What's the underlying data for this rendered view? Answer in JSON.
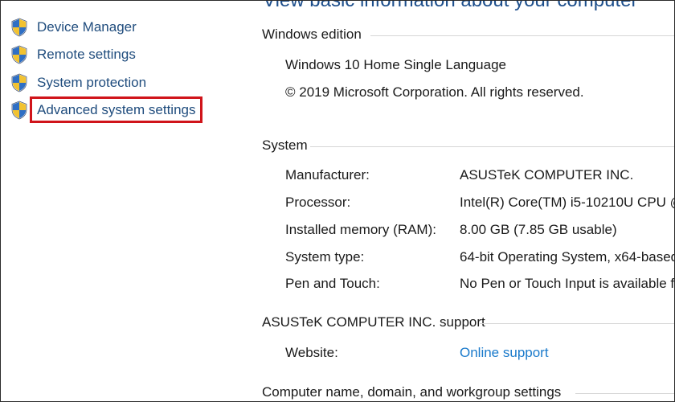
{
  "sidebar": {
    "items": [
      {
        "label": "Device Manager"
      },
      {
        "label": "Remote settings"
      },
      {
        "label": "System protection"
      },
      {
        "label": "Advanced system settings"
      }
    ]
  },
  "main": {
    "page_title": "View basic information about your computer",
    "windows_edition": {
      "header": "Windows edition",
      "edition": "Windows 10 Home Single Language",
      "copyright": "© 2019 Microsoft Corporation. All rights reserved."
    },
    "system": {
      "header": "System",
      "rows": [
        {
          "label": "Manufacturer:",
          "value": "ASUSTeK COMPUTER INC."
        },
        {
          "label": "Processor:",
          "value": "Intel(R) Core(TM) i5-10210U CPU @"
        },
        {
          "label": "Installed memory (RAM):",
          "value": "8.00 GB (7.85 GB usable)"
        },
        {
          "label": "System type:",
          "value": "64-bit Operating System, x64-based"
        },
        {
          "label": "Pen and Touch:",
          "value": "No Pen or Touch Input is available f"
        }
      ]
    },
    "support": {
      "header": "ASUSTeK COMPUTER INC. support",
      "website_label": "Website:",
      "website_link": "Online support"
    },
    "computer_name": {
      "header": "Computer name, domain, and workgroup settings"
    }
  },
  "colors": {
    "nav_link": "#1f4c7d",
    "highlight": "#d0141a",
    "link": "#1a7acb",
    "title": "#1e4f8c"
  },
  "icons": {
    "nav": "uac-shield-icon"
  }
}
